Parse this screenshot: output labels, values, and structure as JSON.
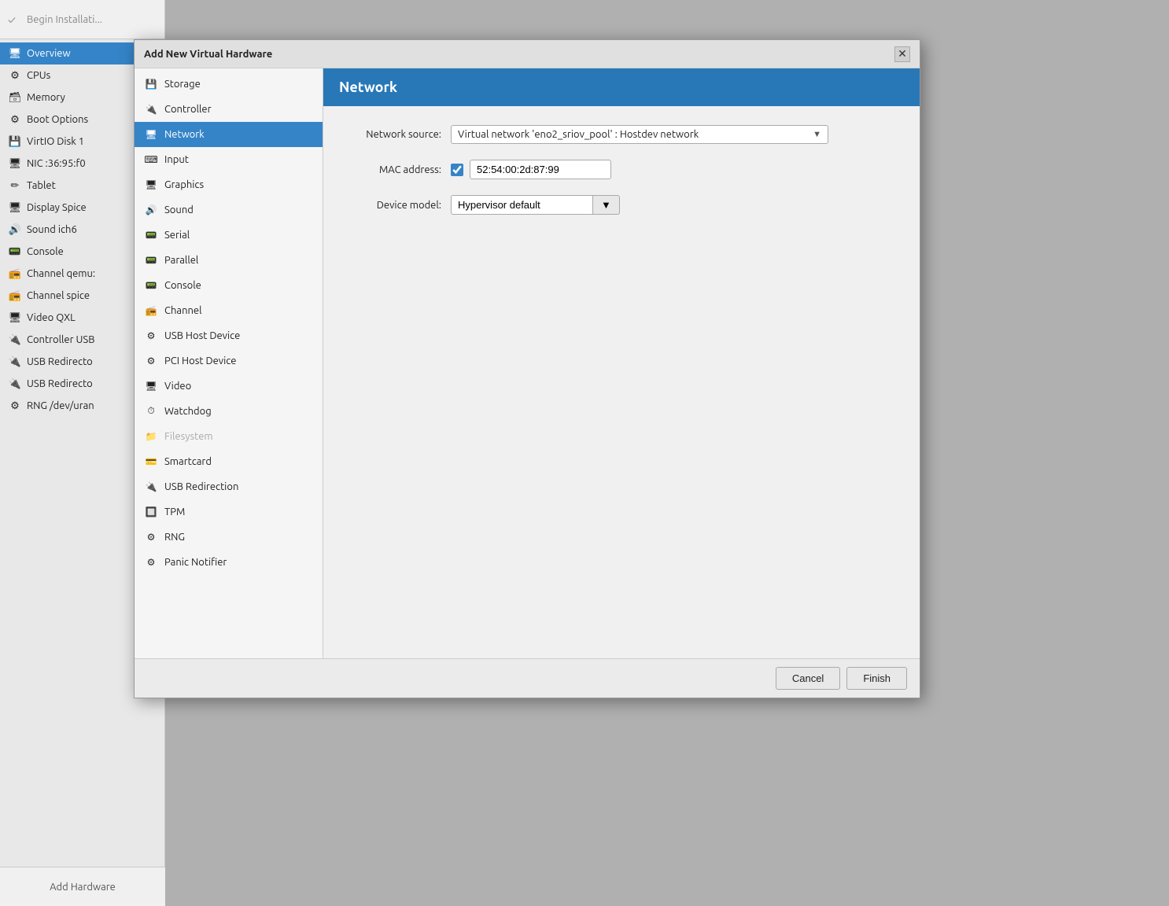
{
  "bg_app": {
    "toolbar_text": "Begin Installati...",
    "add_hardware_label": "Add Hardware"
  },
  "sidebar": {
    "items": [
      {
        "id": "overview",
        "label": "Overview",
        "icon": "🖥",
        "active": true
      },
      {
        "id": "cpus",
        "label": "CPUs",
        "icon": "⚙"
      },
      {
        "id": "memory",
        "label": "Memory",
        "icon": "🗃"
      },
      {
        "id": "boot-options",
        "label": "Boot Options",
        "icon": "⚙"
      },
      {
        "id": "virtio-disk",
        "label": "VirtIO Disk 1",
        "icon": "💾"
      },
      {
        "id": "nic",
        "label": "NIC :36:95:f0",
        "icon": "🖥"
      },
      {
        "id": "tablet",
        "label": "Tablet",
        "icon": "✏"
      },
      {
        "id": "display-spice",
        "label": "Display Spice",
        "icon": "🖥"
      },
      {
        "id": "sound-ich6",
        "label": "Sound ich6",
        "icon": "🔊"
      },
      {
        "id": "console",
        "label": "Console",
        "icon": "📟"
      },
      {
        "id": "channel-qemu",
        "label": "Channel qemu:",
        "icon": "📻"
      },
      {
        "id": "channel-spice",
        "label": "Channel spice",
        "icon": "📻"
      },
      {
        "id": "video-qxl",
        "label": "Video QXL",
        "icon": "🖥"
      },
      {
        "id": "controller-usb",
        "label": "Controller USB",
        "icon": "🔌"
      },
      {
        "id": "usb-redirect1",
        "label": "USB Redirecto",
        "icon": "🔌"
      },
      {
        "id": "usb-redirect2",
        "label": "USB Redirecto",
        "icon": "🔌"
      },
      {
        "id": "rng",
        "label": "RNG /dev/uran",
        "icon": "⚙"
      }
    ]
  },
  "modal": {
    "title": "Add New Virtual Hardware",
    "close_label": "✕",
    "selected_section": "Network",
    "hw_list": [
      {
        "id": "storage",
        "label": "Storage",
        "icon": "💾",
        "disabled": false
      },
      {
        "id": "controller",
        "label": "Controller",
        "icon": "🔌",
        "disabled": false
      },
      {
        "id": "network",
        "label": "Network",
        "icon": "🖥",
        "selected": true,
        "disabled": false
      },
      {
        "id": "input",
        "label": "Input",
        "icon": "⌨",
        "disabled": false
      },
      {
        "id": "graphics",
        "label": "Graphics",
        "icon": "🖥",
        "disabled": false
      },
      {
        "id": "sound",
        "label": "Sound",
        "icon": "🔊",
        "disabled": false
      },
      {
        "id": "serial",
        "label": "Serial",
        "icon": "📟",
        "disabled": false
      },
      {
        "id": "parallel",
        "label": "Parallel",
        "icon": "📟",
        "disabled": false
      },
      {
        "id": "console",
        "label": "Console",
        "icon": "📟",
        "disabled": false
      },
      {
        "id": "channel",
        "label": "Channel",
        "icon": "📻",
        "disabled": false
      },
      {
        "id": "usb-host",
        "label": "USB Host Device",
        "icon": "⚙",
        "disabled": false
      },
      {
        "id": "pci-host",
        "label": "PCI Host Device",
        "icon": "⚙",
        "disabled": false
      },
      {
        "id": "video",
        "label": "Video",
        "icon": "🖥",
        "disabled": false
      },
      {
        "id": "watchdog",
        "label": "Watchdog",
        "icon": "⏱",
        "disabled": false
      },
      {
        "id": "filesystem",
        "label": "Filesystem",
        "icon": "📁",
        "disabled": true
      },
      {
        "id": "smartcard",
        "label": "Smartcard",
        "icon": "💳",
        "disabled": false
      },
      {
        "id": "usb-redirection",
        "label": "USB Redirection",
        "icon": "🔌",
        "disabled": false
      },
      {
        "id": "tpm",
        "label": "TPM",
        "icon": "🔲",
        "disabled": false
      },
      {
        "id": "rng",
        "label": "RNG",
        "icon": "⚙",
        "disabled": false
      },
      {
        "id": "panic-notifier",
        "label": "Panic Notifier",
        "icon": "⚙",
        "disabled": false
      }
    ],
    "network": {
      "header": "Network",
      "network_source_label": "Network source:",
      "network_source_value": "Virtual network 'eno2_sriov_pool' : Hostdev network",
      "mac_address_label": "MAC address:",
      "mac_address_value": "52:54:00:2d:87:99",
      "mac_checked": true,
      "device_model_label": "Device model:",
      "device_model_value": "Hypervisor default"
    },
    "footer": {
      "cancel_label": "Cancel",
      "finish_label": "Finish"
    }
  }
}
